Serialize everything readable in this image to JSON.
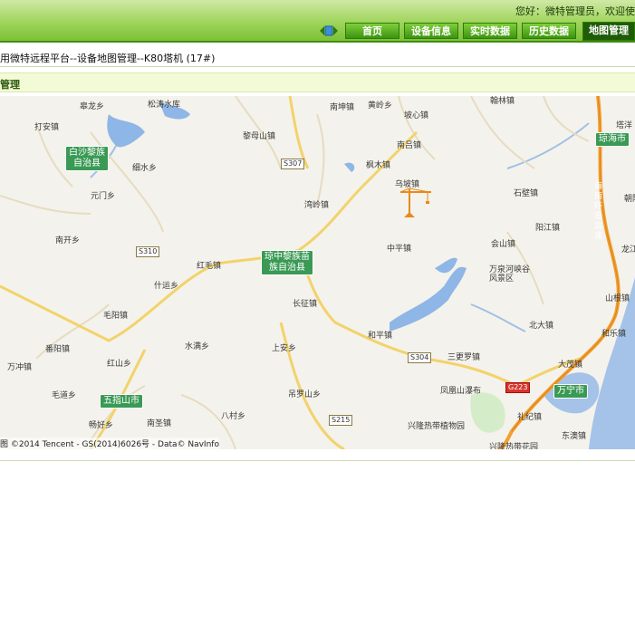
{
  "header": {
    "greeting": "您好：微特管理员，欢迎使",
    "nav": [
      {
        "label": "首页",
        "active": false
      },
      {
        "label": "设备信息",
        "active": false
      },
      {
        "label": "实时数据",
        "active": false
      },
      {
        "label": "历史数据",
        "active": false
      },
      {
        "label": "地图管理",
        "active": true
      }
    ]
  },
  "page": {
    "title": "用微特远程平台--设备地图管理--K80塔机 (17#)",
    "section": "管理"
  },
  "map": {
    "places": [
      "皋龙乡",
      "松涛水库",
      "打安镇",
      "南坤镇",
      "黄岭乡",
      "坡心镇",
      "翰林镇",
      "塔洋",
      "黎母山镇",
      "南吕镇",
      "细水乡",
      "枫木镇",
      "乌坡镇",
      "石壁镇",
      "朝阳",
      "元门乡",
      "湾岭镇",
      "阳江镇",
      "南开乡",
      "中平镇",
      "会山镇",
      "龙江",
      "红毛镇",
      "什运乡",
      "万泉河峡谷风景区",
      "长征镇",
      "山根镇",
      "毛阳镇",
      "北大镇",
      "水满乡",
      "和平镇",
      "和乐镇",
      "番阳镇",
      "上安乡",
      "三更罗镇",
      "大茂镇",
      "红山乡",
      "万冲镇",
      "凤凰山瀑布",
      "毛道乡",
      "吊罗山乡",
      "兴隆热带植物园",
      "八村乡",
      "礼纪镇",
      "畅好乡",
      "南圣镇",
      "东澳镇",
      "兴隆热带花园",
      "海南环岛高速"
    ],
    "badges": [
      "白沙黎族自治县",
      "琼中黎族苗族自治县",
      "琼海市",
      "五指山市",
      "万宁市"
    ],
    "roads": [
      "S307",
      "S310",
      "S304",
      "G223",
      "S215"
    ],
    "copyright": "图  ©2014 Tencent - GS(2014)6026号 - Data© NavInfo",
    "marker": "tower-crane"
  }
}
